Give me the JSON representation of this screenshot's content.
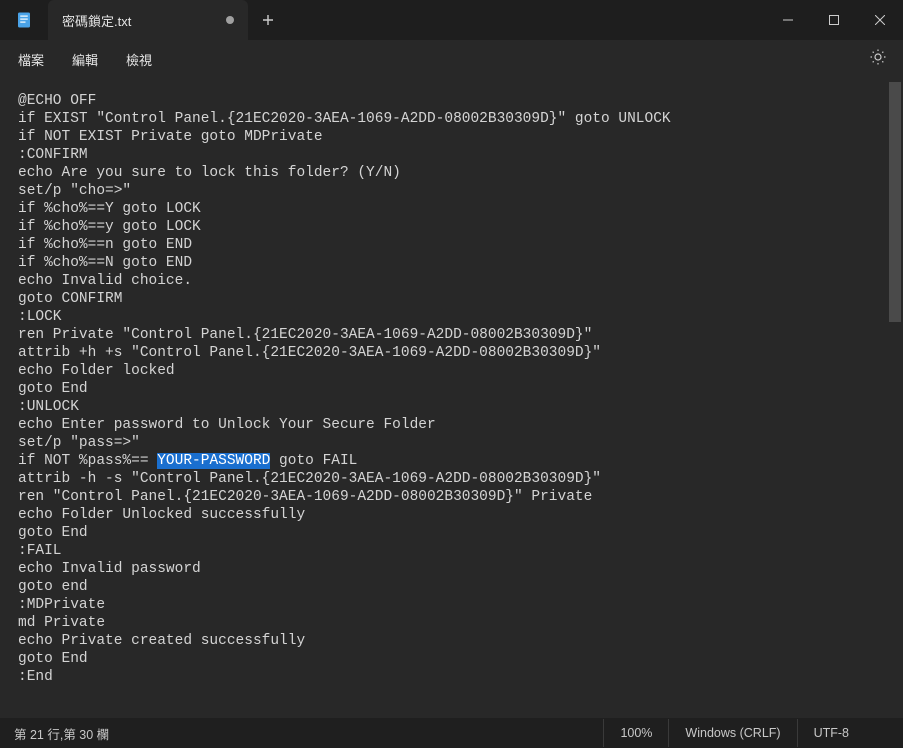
{
  "tab": {
    "title": "密碼鎖定.txt"
  },
  "menu": {
    "file": "檔案",
    "edit": "編輯",
    "view": "檢視"
  },
  "editor": {
    "before_highlight": "@ECHO OFF\nif EXIST \"Control Panel.{21EC2020-3AEA-1069-A2DD-08002B30309D}\" goto UNLOCK\nif NOT EXIST Private goto MDPrivate\n:CONFIRM\necho Are you sure to lock this folder? (Y/N)\nset/p \"cho=>\"\nif %cho%==Y goto LOCK\nif %cho%==y goto LOCK\nif %cho%==n goto END\nif %cho%==N goto END\necho Invalid choice.\ngoto CONFIRM\n:LOCK\nren Private \"Control Panel.{21EC2020-3AEA-1069-A2DD-08002B30309D}\"\nattrib +h +s \"Control Panel.{21EC2020-3AEA-1069-A2DD-08002B30309D}\"\necho Folder locked\ngoto End\n:UNLOCK\necho Enter password to Unlock Your Secure Folder\nset/p \"pass=>\"\nif NOT %pass%== ",
    "highlight": "YOUR-PASSWORD",
    "after_highlight": " goto FAIL\nattrib -h -s \"Control Panel.{21EC2020-3AEA-1069-A2DD-08002B30309D}\"\nren \"Control Panel.{21EC2020-3AEA-1069-A2DD-08002B30309D}\" Private\necho Folder Unlocked successfully\ngoto End\n:FAIL\necho Invalid password\ngoto end\n:MDPrivate\nmd Private\necho Private created successfully\ngoto End\n:End"
  },
  "status": {
    "cursor": "第 21 行,第 30 欄",
    "zoom": "100%",
    "lineending": "Windows (CRLF)",
    "encoding": "UTF-8"
  }
}
